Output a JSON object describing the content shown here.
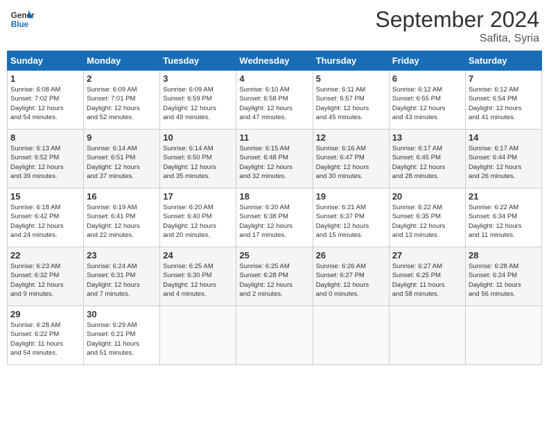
{
  "header": {
    "logo_line1": "General",
    "logo_line2": "Blue",
    "month_title": "September 2024",
    "location": "Safita, Syria"
  },
  "weekdays": [
    "Sunday",
    "Monday",
    "Tuesday",
    "Wednesday",
    "Thursday",
    "Friday",
    "Saturday"
  ],
  "weeks": [
    [
      {
        "day": "1",
        "sunrise": "6:08 AM",
        "sunset": "7:02 PM",
        "daylight": "12 hours and 54 minutes."
      },
      {
        "day": "2",
        "sunrise": "6:09 AM",
        "sunset": "7:01 PM",
        "daylight": "12 hours and 52 minutes."
      },
      {
        "day": "3",
        "sunrise": "6:09 AM",
        "sunset": "6:59 PM",
        "daylight": "12 hours and 49 minutes."
      },
      {
        "day": "4",
        "sunrise": "6:10 AM",
        "sunset": "6:58 PM",
        "daylight": "12 hours and 47 minutes."
      },
      {
        "day": "5",
        "sunrise": "6:11 AM",
        "sunset": "6:57 PM",
        "daylight": "12 hours and 45 minutes."
      },
      {
        "day": "6",
        "sunrise": "6:12 AM",
        "sunset": "6:55 PM",
        "daylight": "12 hours and 43 minutes."
      },
      {
        "day": "7",
        "sunrise": "6:12 AM",
        "sunset": "6:54 PM",
        "daylight": "12 hours and 41 minutes."
      }
    ],
    [
      {
        "day": "8",
        "sunrise": "6:13 AM",
        "sunset": "6:52 PM",
        "daylight": "12 hours and 39 minutes."
      },
      {
        "day": "9",
        "sunrise": "6:14 AM",
        "sunset": "6:51 PM",
        "daylight": "12 hours and 37 minutes."
      },
      {
        "day": "10",
        "sunrise": "6:14 AM",
        "sunset": "6:50 PM",
        "daylight": "12 hours and 35 minutes."
      },
      {
        "day": "11",
        "sunrise": "6:15 AM",
        "sunset": "6:48 PM",
        "daylight": "12 hours and 32 minutes."
      },
      {
        "day": "12",
        "sunrise": "6:16 AM",
        "sunset": "6:47 PM",
        "daylight": "12 hours and 30 minutes."
      },
      {
        "day": "13",
        "sunrise": "6:17 AM",
        "sunset": "6:45 PM",
        "daylight": "12 hours and 28 minutes."
      },
      {
        "day": "14",
        "sunrise": "6:17 AM",
        "sunset": "6:44 PM",
        "daylight": "12 hours and 26 minutes."
      }
    ],
    [
      {
        "day": "15",
        "sunrise": "6:18 AM",
        "sunset": "6:42 PM",
        "daylight": "12 hours and 24 minutes."
      },
      {
        "day": "16",
        "sunrise": "6:19 AM",
        "sunset": "6:41 PM",
        "daylight": "12 hours and 22 minutes."
      },
      {
        "day": "17",
        "sunrise": "6:20 AM",
        "sunset": "6:40 PM",
        "daylight": "12 hours and 20 minutes."
      },
      {
        "day": "18",
        "sunrise": "6:20 AM",
        "sunset": "6:38 PM",
        "daylight": "12 hours and 17 minutes."
      },
      {
        "day": "19",
        "sunrise": "6:21 AM",
        "sunset": "6:37 PM",
        "daylight": "12 hours and 15 minutes."
      },
      {
        "day": "20",
        "sunrise": "6:22 AM",
        "sunset": "6:35 PM",
        "daylight": "12 hours and 13 minutes."
      },
      {
        "day": "21",
        "sunrise": "6:22 AM",
        "sunset": "6:34 PM",
        "daylight": "12 hours and 11 minutes."
      }
    ],
    [
      {
        "day": "22",
        "sunrise": "6:23 AM",
        "sunset": "6:32 PM",
        "daylight": "12 hours and 9 minutes."
      },
      {
        "day": "23",
        "sunrise": "6:24 AM",
        "sunset": "6:31 PM",
        "daylight": "12 hours and 7 minutes."
      },
      {
        "day": "24",
        "sunrise": "6:25 AM",
        "sunset": "6:30 PM",
        "daylight": "12 hours and 4 minutes."
      },
      {
        "day": "25",
        "sunrise": "6:25 AM",
        "sunset": "6:28 PM",
        "daylight": "12 hours and 2 minutes."
      },
      {
        "day": "26",
        "sunrise": "6:26 AM",
        "sunset": "6:27 PM",
        "daylight": "12 hours and 0 minutes."
      },
      {
        "day": "27",
        "sunrise": "6:27 AM",
        "sunset": "6:25 PM",
        "daylight": "11 hours and 58 minutes."
      },
      {
        "day": "28",
        "sunrise": "6:28 AM",
        "sunset": "6:24 PM",
        "daylight": "11 hours and 56 minutes."
      }
    ],
    [
      {
        "day": "29",
        "sunrise": "6:28 AM",
        "sunset": "6:22 PM",
        "daylight": "11 hours and 54 minutes."
      },
      {
        "day": "30",
        "sunrise": "6:29 AM",
        "sunset": "6:21 PM",
        "daylight": "11 hours and 51 minutes."
      },
      null,
      null,
      null,
      null,
      null
    ]
  ]
}
